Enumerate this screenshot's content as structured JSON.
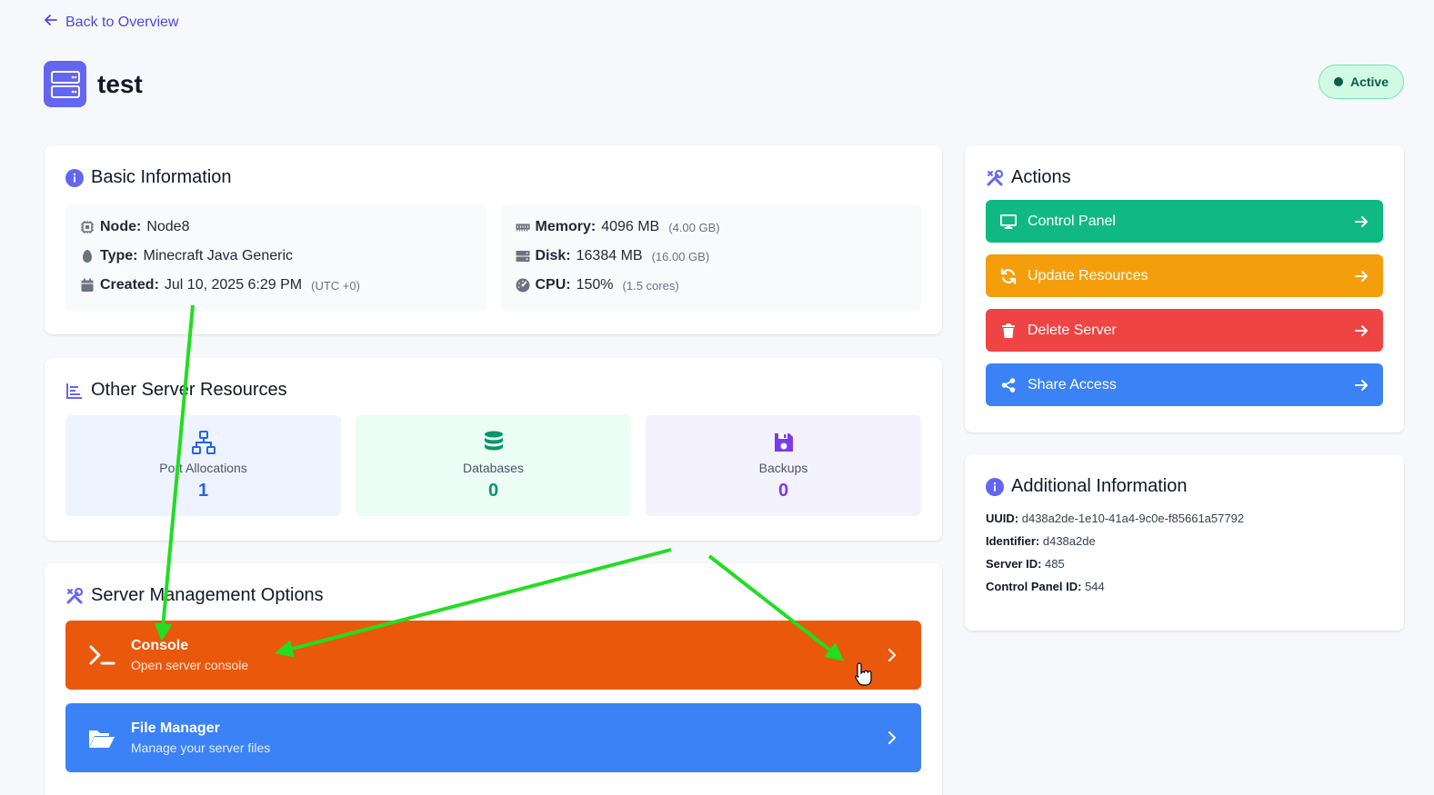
{
  "nav": {
    "back_label": "Back to Overview"
  },
  "server": {
    "name": "test",
    "status": "Active"
  },
  "basic": {
    "title": "Basic Information",
    "left": [
      {
        "label": "Node:",
        "value": "Node8",
        "note": ""
      },
      {
        "label": "Type:",
        "value": "Minecraft Java Generic",
        "note": ""
      },
      {
        "label": "Created:",
        "value": "Jul 10, 2025 6:29 PM",
        "note": "(UTC +0)"
      }
    ],
    "right": [
      {
        "label": "Memory:",
        "value": "4096 MB",
        "note": "(4.00 GB)"
      },
      {
        "label": "Disk:",
        "value": "16384 MB",
        "note": "(16.00 GB)"
      },
      {
        "label": "CPU:",
        "value": "150%",
        "note": "(1.5 cores)"
      }
    ]
  },
  "resources": {
    "title": "Other Server Resources",
    "items": [
      {
        "label": "Port Allocations",
        "value": "1",
        "color": "#2563eb",
        "bg": "#eef4ff"
      },
      {
        "label": "Databases",
        "value": "0",
        "color": "#059669",
        "bg": "#ecfdf5"
      },
      {
        "label": "Backups",
        "value": "0",
        "color": "#7c3aed",
        "bg": "#f3f2fe"
      }
    ]
  },
  "management": {
    "title": "Server Management Options",
    "items": [
      {
        "title": "Console",
        "subtitle": "Open server console",
        "color": "#ea580c"
      },
      {
        "title": "File Manager",
        "subtitle": "Manage your server files",
        "color": "#3b82f6"
      }
    ]
  },
  "actions": {
    "title": "Actions",
    "items": [
      {
        "label": "Control Panel",
        "color": "#10b981",
        "icon": "monitor-icon"
      },
      {
        "label": "Update Resources",
        "color": "#f59e0b",
        "icon": "refresh-icon"
      },
      {
        "label": "Delete Server",
        "color": "#ef4444",
        "icon": "trash-icon"
      },
      {
        "label": "Share Access",
        "color": "#3b82f6",
        "icon": "share-icon"
      }
    ]
  },
  "additional": {
    "title": "Additional Information",
    "rows": [
      {
        "label": "UUID:",
        "value": "d438a2de-1e10-41a4-9c0e-f85661a57792"
      },
      {
        "label": "Identifier:",
        "value": "d438a2de"
      },
      {
        "label": "Server ID:",
        "value": "485"
      },
      {
        "label": "Control Panel ID:",
        "value": "544"
      }
    ]
  },
  "colors": {
    "accent": "#6366f1",
    "annotation": "#22dd22"
  }
}
